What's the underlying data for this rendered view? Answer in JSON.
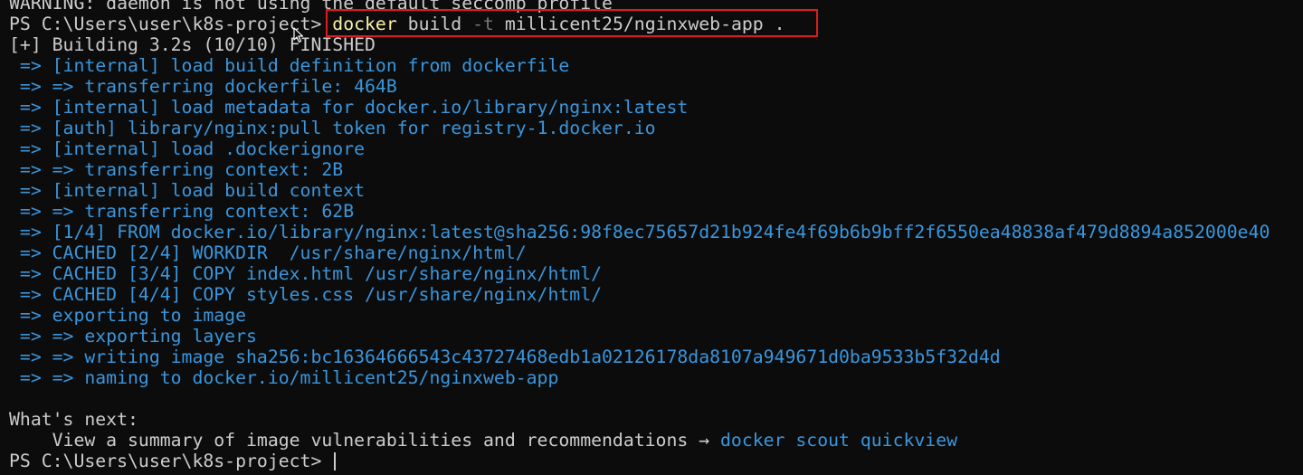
{
  "terminal": {
    "warning_line": "WARNING: daemon is not using the default seccomp profile",
    "prompt": "PS C:\\Users\\user\\k8s-project>",
    "command": {
      "exe": "docker",
      "p1": " build ",
      "flag": "-t",
      "p2": " millicent25/nginxweb-app ."
    },
    "build_status": "[+] Building 3.2s (10/10) FINISHED",
    "build_steps": [
      " => [internal] load build definition from dockerfile",
      " => => transferring dockerfile: 464B",
      " => [internal] load metadata for docker.io/library/nginx:latest",
      " => [auth] library/nginx:pull token for registry-1.docker.io",
      " => [internal] load .dockerignore",
      " => => transferring context: 2B",
      " => [internal] load build context",
      " => => transferring context: 62B",
      " => [1/4] FROM docker.io/library/nginx:latest@sha256:98f8ec75657d21b924fe4f69b6b9bff2f6550ea48838af479d8894a852000e40",
      " => CACHED [2/4] WORKDIR  /usr/share/nginx/html/",
      " => CACHED [3/4] COPY index.html /usr/share/nginx/html/",
      " => CACHED [4/4] COPY styles.css /usr/share/nginx/html/",
      " => exporting to image",
      " => => exporting layers",
      " => => writing image sha256:bc16364666543c43727468edb1a02126178da8107a949671d0ba9533b5f32d4d",
      " => => naming to docker.io/millicent25/nginxweb-app"
    ],
    "whats_next_heading": "What's next:",
    "whats_next_text": "    View a summary of image vulnerabilities and recommendations → ",
    "whats_next_command": "docker scout quickview",
    "final_prompt": "PS C:\\Users\\user\\k8s-project>"
  }
}
